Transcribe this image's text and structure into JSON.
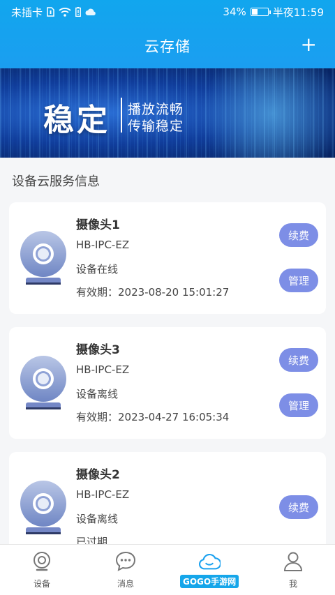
{
  "status_bar": {
    "carrier": "未插卡",
    "battery_percent": "34%",
    "time": "半夜11:59",
    "battery_level": 0.34
  },
  "app_bar": {
    "title": "云存储",
    "add_label": "+"
  },
  "banner": {
    "main_text": "稳定",
    "sub_line1": "播放流畅",
    "sub_line2": "传输稳定"
  },
  "section": {
    "title": "设备云服务信息"
  },
  "devices": [
    {
      "name": "摄像头1",
      "model": "HB-IPC-EZ",
      "status": "设备在线",
      "expiry": "有效期：2023-08-20 15:01:27",
      "renew_label": "续费",
      "manage_label": "管理"
    },
    {
      "name": "摄像头3",
      "model": "HB-IPC-EZ",
      "status": "设备离线",
      "expiry": "有效期：2023-04-27 16:05:34",
      "renew_label": "续费",
      "manage_label": "管理"
    },
    {
      "name": "摄像头2",
      "model": "HB-IPC-EZ",
      "status": "设备离线",
      "expiry": "已过期",
      "renew_label": "续费"
    }
  ],
  "bottom_nav": [
    {
      "label": "设备",
      "icon": "camera-icon"
    },
    {
      "label": "消息",
      "icon": "chat-icon"
    },
    {
      "label": "",
      "icon": "cloud-icon",
      "active": true
    },
    {
      "label": "我",
      "icon": "user-icon"
    }
  ],
  "watermark": {
    "text": "GOGO手游网"
  },
  "colors": {
    "header_blue": "#1b9ef0",
    "pill_purple": "#7d8ee6",
    "active_blue": "#1ba1ef"
  }
}
